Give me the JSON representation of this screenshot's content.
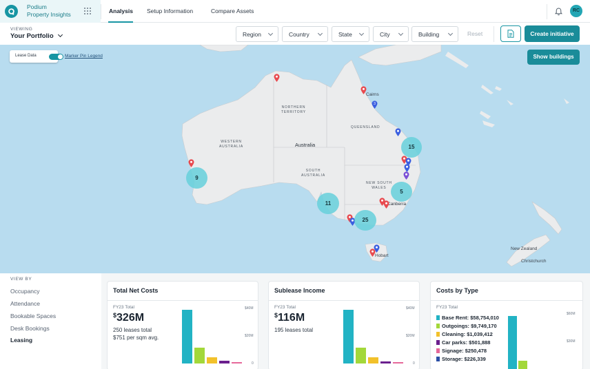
{
  "app": {
    "name_line1": "Podium",
    "name_line2": "Property Insights",
    "user_initials": "RC"
  },
  "tabs": [
    "Analysis",
    "Setup Information",
    "Compare Assets"
  ],
  "viewing": {
    "label": "VIEWING",
    "value": "Your Portfolio"
  },
  "filters": [
    "Region",
    "Country",
    "State",
    "City",
    "Building"
  ],
  "filter_reset": "Reset",
  "create_button": "Create initiative",
  "map": {
    "lease_toggle_label": "Lease Data",
    "lease_toggle_on": true,
    "legend_link": "Marker Pin Legend",
    "show_buildings": "Show buildings",
    "labels": {
      "northern_territory": "NORTHERN\nTERRITORY",
      "queensland": "QUEENSLAND",
      "western_australia": "WESTERN\nAUSTRALIA",
      "australia": "Australia",
      "south_australia": "SOUTH\nAUSTRALIA",
      "new_south_wales": "NEW SOUTH\nWALES",
      "cairns": "Cairns",
      "canberra": "Canberra",
      "hobart": "Hobart",
      "new_zealand": "New Zealand",
      "christchurch": "Christchurch"
    },
    "clusters": [
      15,
      9,
      5,
      11,
      25
    ],
    "pin_colors": {
      "red": "#e84a4f",
      "blue": "#3b5fe0",
      "purple": "#7b4fd6"
    }
  },
  "view_by": {
    "label": "VIEW BY",
    "items": [
      "Occupancy",
      "Attendance",
      "Bookable Spaces",
      "Desk Bookings",
      "Leasing"
    ],
    "active": "Leasing"
  },
  "cards": {
    "net_costs": {
      "title": "Total Net Costs",
      "period": "FY23 Total",
      "currency": "$",
      "value": "326M",
      "line1": "250 leases total",
      "line2": "$751 per sqm avg.",
      "axis": [
        "$40M",
        "$20M",
        "0"
      ]
    },
    "sublease": {
      "title": "Sublease Income",
      "period": "FY23 Total",
      "currency": "$",
      "value": "116M",
      "line1": "195 leases total",
      "axis": [
        "$40M",
        "$20M",
        "0"
      ]
    },
    "costs_by_type": {
      "title": "Costs by Type",
      "period": "FY23 Total",
      "axis": [
        "$60M",
        "$30M"
      ],
      "rows": [
        {
          "label": "Base Rent: $58,754,010",
          "color": "#22b3c4"
        },
        {
          "label": "Outgoings: $9,749,170",
          "color": "#a3d83a"
        },
        {
          "label": "Cleaning: $1,039,412",
          "color": "#f2c12b"
        },
        {
          "label": "Car parks: $501,888",
          "color": "#6b1f8e"
        },
        {
          "label": "Signage: $250,478",
          "color": "#e6689a"
        },
        {
          "label": "Storage: $226,339",
          "color": "#2b4fa5"
        }
      ]
    }
  },
  "chart_data": {
    "type": "bar",
    "title": "Costs by Type",
    "categories": [
      "Base Rent",
      "Outgoings",
      "Cleaning",
      "Car parks",
      "Signage",
      "Storage"
    ],
    "values": [
      58754010,
      9749170,
      1039412,
      501888,
      250478,
      226339
    ],
    "ylim": [
      0,
      60000000
    ]
  }
}
